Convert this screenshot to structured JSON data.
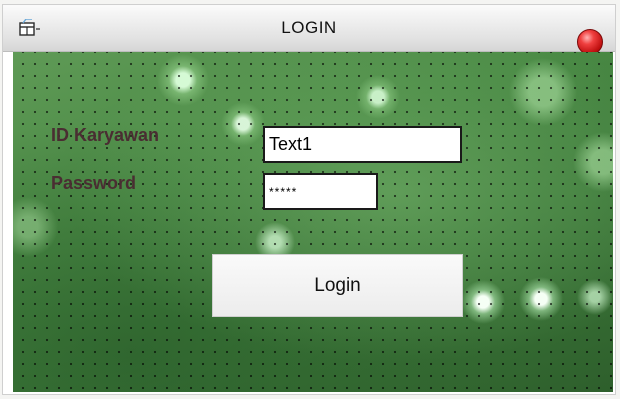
{
  "window": {
    "title": "LOGIN",
    "icon": "form-icon",
    "close_icon": "close-icon"
  },
  "form": {
    "id_label": "ID Karyawan",
    "id_value": "Text1",
    "password_label": "Password",
    "password_value": "*****",
    "login_button": "Login"
  },
  "colors": {
    "background": "#4a8a45",
    "label_text": "#4a2d32",
    "close_button": "#d01818"
  }
}
